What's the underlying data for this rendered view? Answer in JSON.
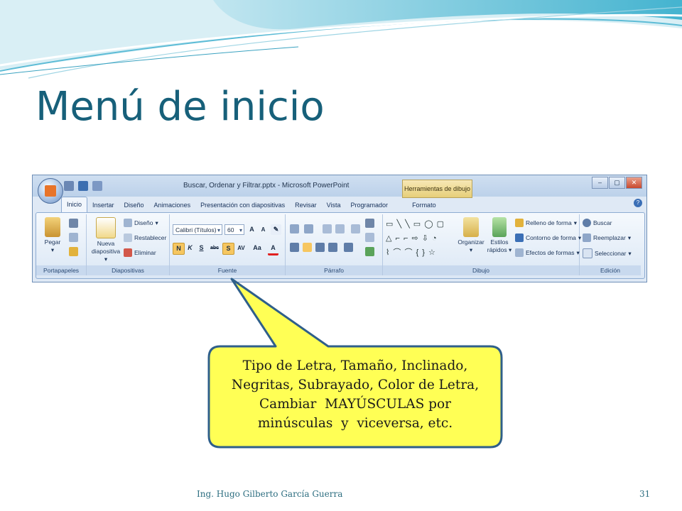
{
  "slide": {
    "title": "Menú de inicio",
    "footer_author": "Ing. Hugo Gilberto García Guerra",
    "page_number": "31"
  },
  "colors": {
    "title": "#17607a",
    "callout_fill": "#ffff55",
    "callout_stroke": "#2f5f8a",
    "ribbon": "#dfe9f5"
  },
  "window": {
    "doc_title": "Buscar, Ordenar y Filtrar.pptx - Microsoft PowerPoint",
    "context_tab": "Herramientas de dibujo"
  },
  "ribbon_tabs": [
    "Inicio",
    "Insertar",
    "Diseño",
    "Animaciones",
    "Presentación con diapositivas",
    "Revisar",
    "Vista",
    "Programador",
    "Formato"
  ],
  "groups": {
    "portapapeles": {
      "label": "Portapapeles",
      "pegar": "Pegar"
    },
    "diapositivas": {
      "label": "Diapositivas",
      "nueva": "Nueva",
      "diapositiva": "diapositiva",
      "diseno": "Diseño",
      "restablecer": "Restablecer",
      "eliminar": "Eliminar"
    },
    "fuente": {
      "label": "Fuente",
      "font": "Calibri (Títulos)",
      "size": "60",
      "bold": "N",
      "italic": "K",
      "underline": "S",
      "strike": "abc",
      "shadow": "S",
      "case": "Aa"
    },
    "parrafo": {
      "label": "Párrafo"
    },
    "dibujo": {
      "label": "Dibujo",
      "organizar": "Organizar",
      "estilos": "Estilos",
      "rapidos": "rápidos",
      "relleno": "Relleno de forma",
      "contorno": "Contorno de forma",
      "efectos": "Efectos de formas"
    },
    "edicion": {
      "label": "Edición",
      "buscar": "Buscar",
      "reemplazar": "Reemplazar",
      "seleccionar": "Seleccionar"
    }
  },
  "callout": {
    "lines": [
      "Tipo de Letra, Tamaño, Inclinado,",
      "Negritas, Subrayado, Color de Letra,",
      "Cambiar  MAYÚSCULAS por",
      "minúsculas  y  viceversa, etc."
    ]
  },
  "icons": [
    "office-button-icon",
    "save-icon",
    "undo-icon",
    "redo-icon",
    "paste-icon",
    "scissors-icon",
    "copy-icon",
    "format-painter-icon",
    "new-slide-icon",
    "find-icon",
    "replace-icon",
    "select-icon",
    "help-icon"
  ]
}
